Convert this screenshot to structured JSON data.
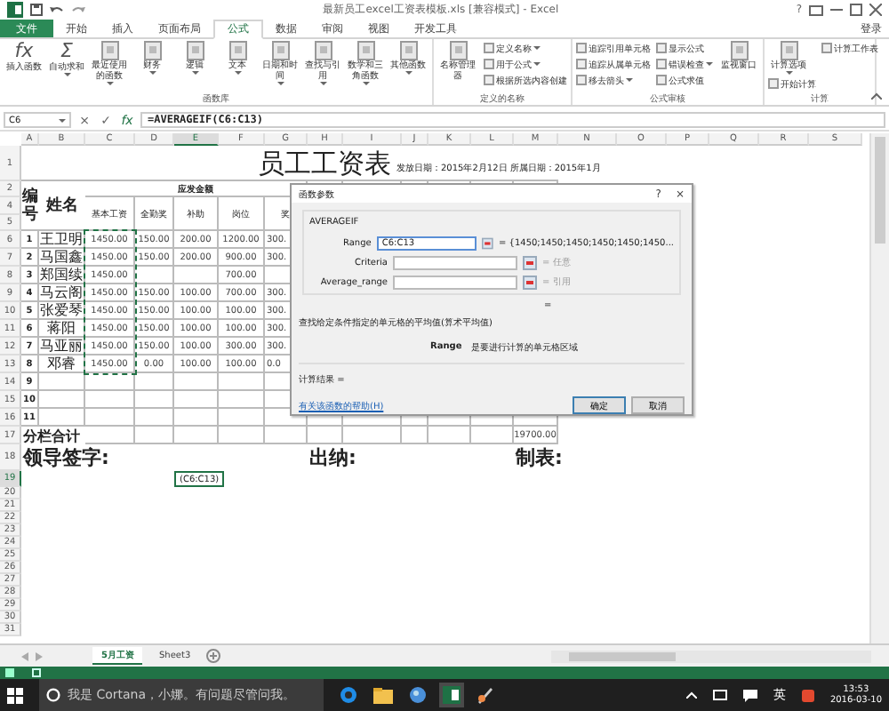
{
  "window": {
    "title": "最新员工excel工资表模板.xls [兼容模式] - Excel",
    "help": "?"
  },
  "tabs": [
    {
      "label": "文件",
      "kind": "file",
      "selected": false
    },
    {
      "label": "开始",
      "kind": "tab",
      "selected": false
    },
    {
      "label": "插入",
      "kind": "tab",
      "selected": false
    },
    {
      "label": "页面布局",
      "kind": "tab",
      "selected": false
    },
    {
      "label": "公式",
      "kind": "tab",
      "selected": true
    },
    {
      "label": "数据",
      "kind": "tab",
      "selected": false
    },
    {
      "label": "审阅",
      "kind": "tab",
      "selected": false
    },
    {
      "label": "视图",
      "kind": "tab",
      "selected": false
    },
    {
      "label": "开发工具",
      "kind": "tab",
      "selected": false
    }
  ],
  "account": "登录",
  "ribbon": {
    "groups": [
      {
        "label": "函数库",
        "items": [
          {
            "label": "插入函数",
            "kind": "large",
            "glyph": "fx",
            "dropdown": false
          },
          {
            "label": "自动求和",
            "kind": "large",
            "glyph": "Σ",
            "dropdown": true
          },
          {
            "label": "最近使用的函数",
            "kind": "large",
            "dropdown": true
          },
          {
            "label": "财务",
            "kind": "large",
            "dropdown": true
          },
          {
            "label": "逻辑",
            "kind": "large",
            "dropdown": true
          },
          {
            "label": "文本",
            "kind": "large",
            "dropdown": true
          },
          {
            "label": "日期和时间",
            "kind": "large",
            "dropdown": true
          },
          {
            "label": "查找与引用",
            "kind": "large",
            "dropdown": true
          },
          {
            "label": "数学和三角函数",
            "kind": "large",
            "dropdown": true
          },
          {
            "label": "其他函数",
            "kind": "large",
            "dropdown": true
          }
        ]
      },
      {
        "label": "定义的名称",
        "items": [
          {
            "label": "名称管理器",
            "kind": "large",
            "dropdown": false
          },
          {
            "label": "定义名称",
            "kind": "small",
            "dropdown": true
          },
          {
            "label": "用于公式",
            "kind": "small",
            "dropdown": true
          },
          {
            "label": "根据所选内容创建",
            "kind": "small",
            "dropdown": false
          }
        ]
      },
      {
        "label": "公式审核",
        "items": [
          {
            "label": "追踪引用单元格",
            "kind": "small",
            "dropdown": false
          },
          {
            "label": "追踪从属单元格",
            "kind": "small",
            "dropdown": false
          },
          {
            "label": "移去箭头",
            "kind": "small",
            "dropdown": true
          },
          {
            "label": "显示公式",
            "kind": "small",
            "dropdown": false
          },
          {
            "label": "错误检查",
            "kind": "small",
            "dropdown": true
          },
          {
            "label": "公式求值",
            "kind": "small",
            "dropdown": false
          },
          {
            "label": "监视窗口",
            "kind": "large",
            "dropdown": false
          }
        ]
      },
      {
        "label": "计算",
        "items": [
          {
            "label": "计算选项",
            "kind": "large",
            "dropdown": true
          },
          {
            "label": "开始计算",
            "kind": "small",
            "dropdown": false
          },
          {
            "label": "计算工作表",
            "kind": "small",
            "dropdown": false
          }
        ]
      }
    ]
  },
  "formula_bar": {
    "name_box": "C6",
    "cancel": "×",
    "enter": "✓",
    "function": "fx",
    "formula": "=AVERAGEIF(C6:C13)"
  },
  "sheet": {
    "columns": [
      {
        "label": "A",
        "selected": false
      },
      {
        "label": "B",
        "selected": false
      },
      {
        "label": "C",
        "selected": false
      },
      {
        "label": "D",
        "selected": false
      },
      {
        "label": "E",
        "selected": true
      },
      {
        "label": "F",
        "selected": false
      },
      {
        "label": "G",
        "selected": false
      },
      {
        "label": "H",
        "selected": false
      },
      {
        "label": "I",
        "selected": false
      },
      {
        "label": "J",
        "selected": false
      },
      {
        "label": "K",
        "selected": false
      },
      {
        "label": "L",
        "selected": false
      },
      {
        "label": "M",
        "selected": false
      },
      {
        "label": "N",
        "selected": false
      },
      {
        "label": "O",
        "selected": false
      },
      {
        "label": "P",
        "selected": false
      },
      {
        "label": "Q",
        "selected": false
      },
      {
        "label": "R",
        "selected": false
      },
      {
        "label": "S",
        "selected": false
      }
    ],
    "row_headers": [
      {
        "label": "1",
        "selected": false
      },
      {
        "label": "2",
        "selected": false
      },
      {
        "label": "4",
        "selected": false
      },
      {
        "label": "5",
        "selected": false
      },
      {
        "label": "6",
        "selected": false
      },
      {
        "label": "7",
        "selected": false
      },
      {
        "label": "8",
        "selected": false
      },
      {
        "label": "9",
        "selected": false
      },
      {
        "label": "10",
        "selected": false
      },
      {
        "label": "11",
        "selected": false
      },
      {
        "label": "12",
        "selected": false
      },
      {
        "label": "13",
        "selected": false
      },
      {
        "label": "14",
        "selected": false
      },
      {
        "label": "15",
        "selected": false
      },
      {
        "label": "16",
        "selected": false
      },
      {
        "label": "17",
        "selected": false
      },
      {
        "label": "18",
        "selected": false
      },
      {
        "label": "19",
        "selected": true
      },
      {
        "label": "20",
        "selected": false
      },
      {
        "label": "21",
        "selected": false
      },
      {
        "label": "22",
        "selected": false
      },
      {
        "label": "23",
        "selected": false
      },
      {
        "label": "24",
        "selected": false
      },
      {
        "label": "25",
        "selected": false
      },
      {
        "label": "26",
        "selected": false
      },
      {
        "label": "27",
        "selected": false
      },
      {
        "label": "28",
        "selected": false
      },
      {
        "label": "29",
        "selected": false
      },
      {
        "label": "30",
        "selected": false
      },
      {
        "label": "31",
        "selected": false
      }
    ],
    "title": "员工工资表",
    "issue_info": "发放日期：2015年2月12日 所属日期：2015年1月",
    "header": {
      "number": "编号",
      "name": "姓名",
      "group": "应发金额",
      "columns": [
        "基本工资",
        "全勤奖",
        "补助",
        "岗位",
        "奖"
      ]
    },
    "rows": [
      {
        "number": "1",
        "name": "王卫明",
        "values": {
          "basic": "1450.00",
          "attendance": "150.00",
          "allowance": "200.00",
          "post": "1200.00",
          "column_5": "300."
        }
      },
      {
        "number": "2",
        "name": "马国鑫",
        "values": {
          "basic": "1450.00",
          "attendance": "150.00",
          "allowance": "200.00",
          "post": "900.00",
          "column_5": "300."
        }
      },
      {
        "number": "3",
        "name": "郑国续",
        "values": {
          "basic": "1450.00",
          "post": "700.00"
        }
      },
      {
        "number": "4",
        "name": "马云阁",
        "values": {
          "basic": "1450.00",
          "attendance": "150.00",
          "allowance": "100.00",
          "post": "700.00",
          "column_5": "300."
        }
      },
      {
        "number": "5",
        "name": "张爱琴",
        "values": {
          "basic": "1450.00",
          "attendance": "150.00",
          "allowance": "100.00",
          "post": "100.00",
          "column_5": "300."
        }
      },
      {
        "number": "6",
        "name": "蒋阳",
        "values": {
          "basic": "1450.00",
          "attendance": "150.00",
          "allowance": "100.00",
          "post": "100.00",
          "column_5": "300."
        }
      },
      {
        "number": "7",
        "name": "马亚丽",
        "values": {
          "basic": "1450.00",
          "attendance": "150.00",
          "allowance": "100.00",
          "post": "300.00",
          "column_5": "300."
        }
      },
      {
        "number": "8",
        "name": "邓睿",
        "values": {
          "basic": "1450.00",
          "attendance": "0.00",
          "allowance": "100.00",
          "post": "100.00",
          "column_5": "0.0"
        }
      }
    ],
    "extra_rows": [
      "9",
      "10",
      "11"
    ],
    "total": {
      "label": "分栏合计",
      "value": "19700.00"
    },
    "signatures": [
      "领导签字:",
      "出纳:",
      "制表:"
    ],
    "range_highlight": true,
    "active_cell": "(C6:C13)"
  },
  "dialog": {
    "title": "函数参数",
    "help": "?",
    "close": "×",
    "function": "AVERAGEIF",
    "arguments": [
      {
        "label": "Range",
        "value": "C6:C13",
        "result": "= {1450;1450;1450;1450;1450;1450...",
        "kind": "value"
      },
      {
        "label": "Criteria",
        "result": "= 任意",
        "kind": "hint"
      },
      {
        "label": "Average_range",
        "result": "= 引用",
        "kind": "hint"
      }
    ],
    "formula_result": "=",
    "description": "查找给定条件指定的单元格的平均值(算术平均值)",
    "argument_help": {
      "name": "Range",
      "text": "是要进行计算的单元格区域"
    },
    "calc_result": "计算结果 =",
    "help_link": "有关该函数的帮助(H)",
    "buttons": [
      {
        "label": "确定",
        "default": true
      },
      {
        "label": "取消",
        "default": false
      }
    ]
  },
  "sheet_tabs": [
    {
      "label": "5月工资",
      "selected": true
    },
    {
      "label": "Sheet3",
      "selected": false
    }
  ],
  "taskbar": {
    "search_placeholder": "我是 Cortana，小娜。有问题尽管问我。",
    "ime": "英",
    "time": "13:53",
    "date": "2016-03-10"
  }
}
